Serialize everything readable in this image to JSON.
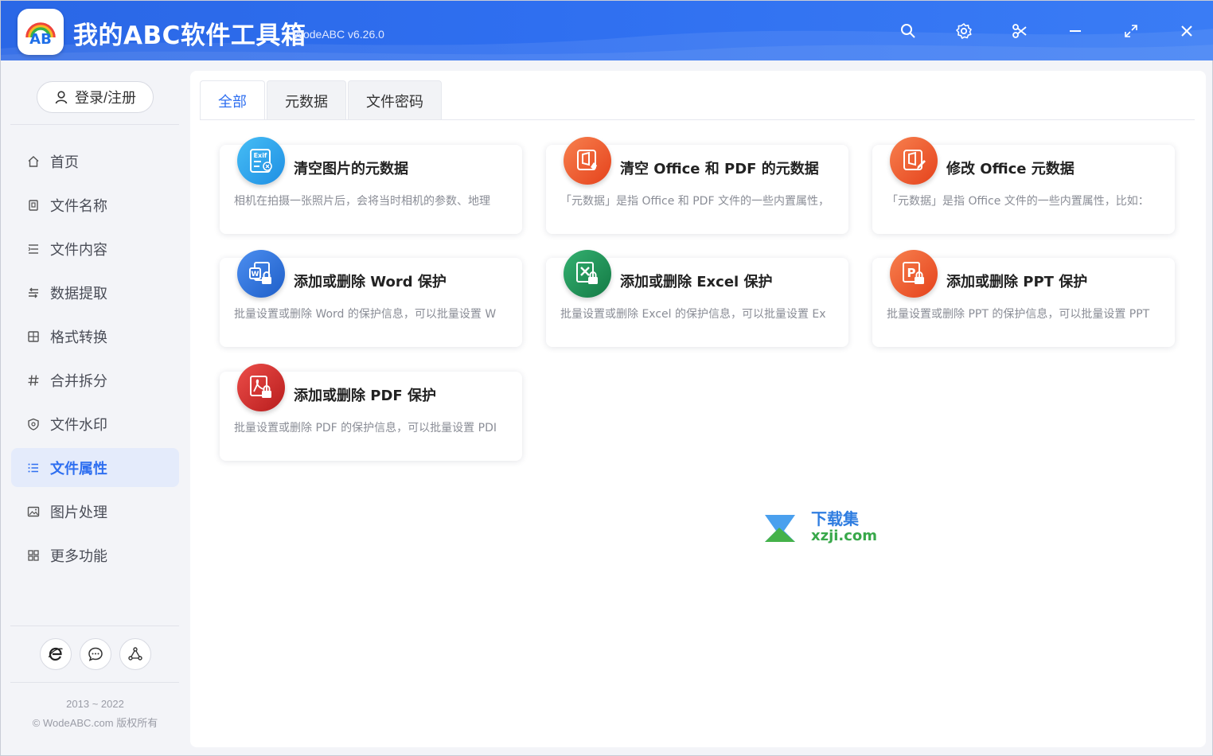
{
  "app": {
    "title": "我的ABC软件工具箱",
    "version": "WodeABC v6.26.0",
    "logo_text": "AB"
  },
  "titlebar_buttons": [
    "search-icon",
    "gear-icon",
    "scissors-icon",
    "minimize-icon",
    "maximize-icon",
    "close-icon"
  ],
  "sidebar": {
    "login_label": "登录/注册",
    "items": [
      {
        "label": "首页",
        "icon": "home-icon"
      },
      {
        "label": "文件名称",
        "icon": "file-name-icon"
      },
      {
        "label": "文件内容",
        "icon": "file-content-icon"
      },
      {
        "label": "数据提取",
        "icon": "data-extract-icon"
      },
      {
        "label": "格式转换",
        "icon": "format-convert-icon"
      },
      {
        "label": "合并拆分",
        "icon": "merge-split-icon"
      },
      {
        "label": "文件水印",
        "icon": "watermark-icon"
      },
      {
        "label": "文件属性",
        "icon": "file-property-icon",
        "active": true
      },
      {
        "label": "图片处理",
        "icon": "image-icon"
      },
      {
        "label": "更多功能",
        "icon": "more-icon"
      }
    ],
    "footer_buttons": [
      "browser-icon",
      "chat-icon",
      "share-icon"
    ],
    "copyright_years": "2013 ~ 2022",
    "copyright_text": "© WodeABC.com 版权所有"
  },
  "tabs": [
    {
      "label": "全部",
      "active": true
    },
    {
      "label": "元数据"
    },
    {
      "label": "文件密码"
    }
  ],
  "cards": [
    {
      "title": "清空图片的元数据",
      "desc": "相机在拍摄一张照片后，会将当时相机的参数、地理",
      "color": "#2aa3ee",
      "icon": "exif-icon"
    },
    {
      "title": "清空 Office 和 PDF 的元数据",
      "desc": "「元数据」是指 Office 和 PDF 文件的一些内置属性，",
      "color": "#f05a2d",
      "icon": "office-clean-icon"
    },
    {
      "title": "修改 Office 元数据",
      "desc": "「元数据」是指 Office 文件的一些内置属性，比如：",
      "color": "#f05a2d",
      "icon": "office-edit-icon"
    },
    {
      "title": "添加或删除 Word 保护",
      "desc": "批量设置或删除 Word 的保护信息，可以批量设置 W",
      "color": "#2f6fd8",
      "icon": "word-lock-icon"
    },
    {
      "title": "添加或删除 Excel 保护",
      "desc": "批量设置或删除 Excel 的保护信息，可以批量设置 Ex",
      "color": "#1f9a5a",
      "icon": "excel-lock-icon"
    },
    {
      "title": "添加或删除 PPT 保护",
      "desc": "批量设置或删除 PPT 的保护信息，可以批量设置 PPT",
      "color": "#ee5a30",
      "icon": "ppt-lock-icon"
    },
    {
      "title": "添加或删除 PDF 保护",
      "desc": "批量设置或删除 PDF 的保护信息，可以批量设置 PDI",
      "color": "#d8322f",
      "icon": "pdf-lock-icon"
    }
  ],
  "watermark": {
    "line1": "下载集",
    "line2": "xzji.com"
  }
}
